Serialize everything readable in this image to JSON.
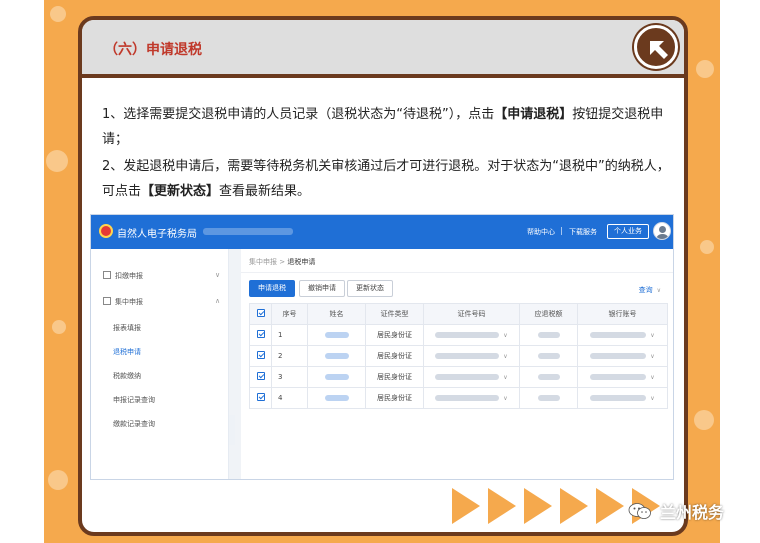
{
  "section": {
    "title": "（六）申请退税"
  },
  "instructions": {
    "p1_pre": "1、选择需要提交退税申请的人员记录（退税状态为“待退税”），点击",
    "p1_btn": "【申请退税】",
    "p1_post": "按钮提交退税申请；",
    "p2_pre": "2、发起退税申请后，需要等待税务机关审核通过后才可进行退税。对于状态为“退税中”的纳税人，可点击",
    "p2_btn": "【更新状态】",
    "p2_post": "查看最新结果。"
  },
  "app": {
    "brand": "自然人电子税务局",
    "top_links": {
      "help": "帮助中心",
      "download": "下载服务",
      "personal": "个人业务"
    },
    "sidebar": {
      "groups": [
        {
          "label": "扣缴申报"
        },
        {
          "label": "集中申报"
        }
      ],
      "items": [
        {
          "label": "报表填报"
        },
        {
          "label": "退税申请"
        },
        {
          "label": "税款缴纳"
        },
        {
          "label": "申报记录查询"
        },
        {
          "label": "缴款记录查询"
        }
      ]
    },
    "breadcrumb": {
      "parent": "集中申报",
      "sep": ">",
      "current": "退税申请"
    },
    "toolbar": {
      "apply": "申请退税",
      "revoke": "撤销申请",
      "update": "更新状态",
      "query": "查询"
    },
    "table": {
      "headers": [
        "序号",
        "姓名",
        "证件类型",
        "证件号码",
        "应退税额",
        "银行账号"
      ],
      "rows": [
        {
          "index": "1",
          "id_type": "居民身份证"
        },
        {
          "index": "2",
          "id_type": "居民身份证"
        },
        {
          "index": "3",
          "id_type": "居民身份证"
        },
        {
          "index": "4",
          "id_type": "居民身份证"
        }
      ]
    }
  },
  "footer": {
    "account": "兰州税务"
  },
  "colors": {
    "accent_blue": "#1f6fd6",
    "title_red": "#c0392b",
    "frame_brown": "#6b3a1e",
    "bg_orange": "#f5a94d"
  }
}
